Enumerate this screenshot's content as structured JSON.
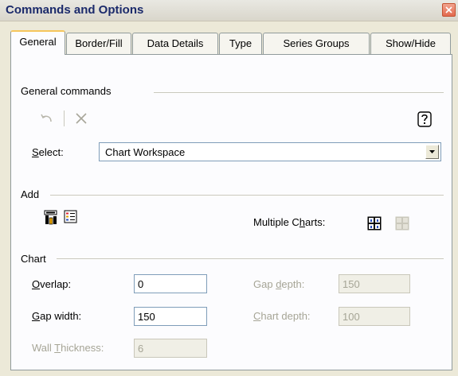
{
  "window": {
    "title": "Commands and Options"
  },
  "tabs": [
    {
      "label": "General",
      "active": true
    },
    {
      "label": "Border/Fill",
      "active": false
    },
    {
      "label": "Data Details",
      "active": false
    },
    {
      "label": "Type",
      "active": false
    },
    {
      "label": "Series Groups",
      "active": false
    },
    {
      "label": "Show/Hide",
      "active": false
    }
  ],
  "general": {
    "section_label": "General commands",
    "undo_icon": "undo-icon",
    "delete_icon": "delete-x-icon",
    "help_icon": "help-icon",
    "select_label": "Select:",
    "select_value": "Chart Workspace"
  },
  "add": {
    "section_label": "Add",
    "multiple_charts_label": "Multiple Charts:",
    "icons": [
      "chart-wizard-icon",
      "legend-icon",
      "multiple-charts-icon",
      "multiple-charts-disabled-icon"
    ]
  },
  "chart": {
    "section_label": "Chart",
    "overlap_label": "Overlap:",
    "overlap_value": "0",
    "gap_width_label": "Gap width:",
    "gap_width_value": "150",
    "wall_thickness_label": "Wall Thickness:",
    "wall_thickness_value": "6",
    "gap_depth_label": "Gap depth:",
    "gap_depth_value": "150",
    "chart_depth_label": "Chart depth:",
    "chart_depth_value": "100"
  },
  "colors": {
    "tab_accent": "#f6c65c",
    "title_text": "#1b2a6b",
    "close_red": "#e26a4f"
  }
}
